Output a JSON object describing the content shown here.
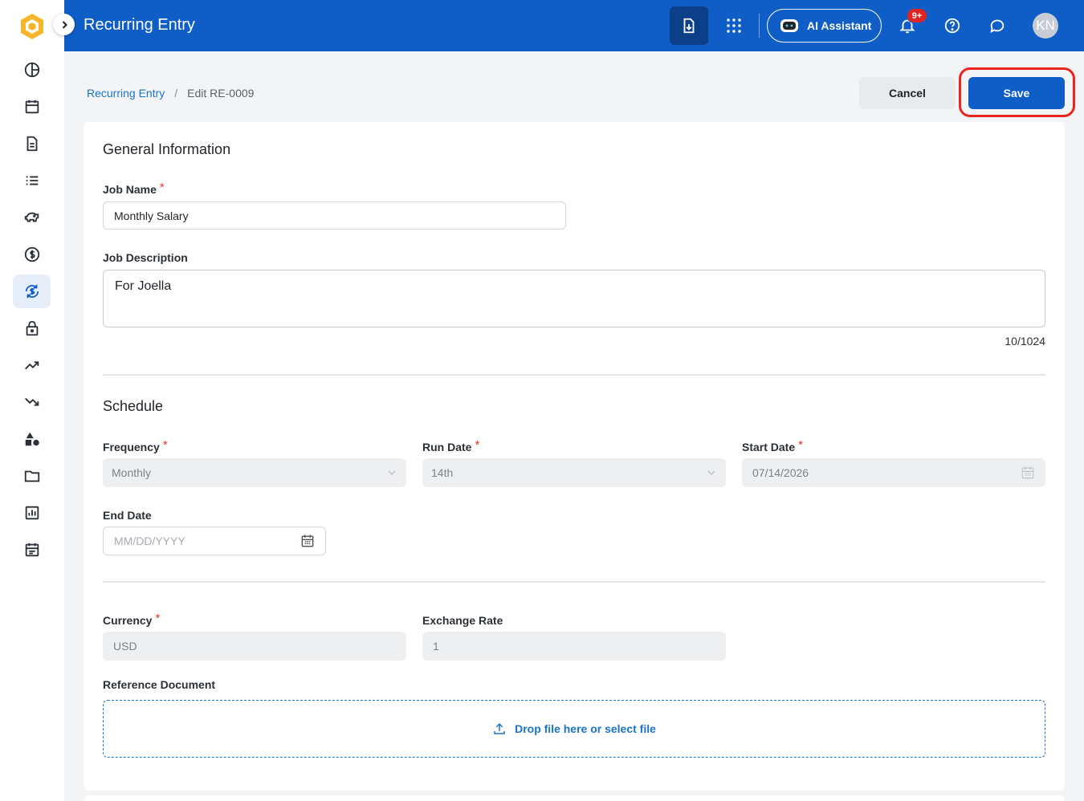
{
  "header": {
    "title": "Recurring Entry",
    "ai_assistant_label": "AI Assistant",
    "notification_badge": "9+",
    "avatar_initials": "KN",
    "brand_color": "#0f5ec8"
  },
  "sidebar": {
    "active_item": "recurring-entry",
    "items": [
      "dashboard-icon",
      "calendar-icon",
      "document-icon",
      "list-icon",
      "piggy-bank-icon",
      "dollar-icon",
      "recurring-dollar-icon",
      "lock-icon",
      "trending-up-icon",
      "trending-down-icon",
      "shapes-icon",
      "folder-icon",
      "report-icon",
      "schedule-icon"
    ]
  },
  "breadcrumb": {
    "parent": "Recurring Entry",
    "separator": "/",
    "current": "Edit RE-0009"
  },
  "actions": {
    "cancel_label": "Cancel",
    "save_label": "Save"
  },
  "general": {
    "section_title": "General Information",
    "job_name_label": "Job Name",
    "job_name_value": "Monthly Salary",
    "job_description_label": "Job Description",
    "job_description_value": "For Joella",
    "char_counter": "10/1024"
  },
  "schedule": {
    "section_title": "Schedule",
    "frequency_label": "Frequency",
    "frequency_value": "Monthly",
    "run_date_label": "Run Date",
    "run_date_value": "14th",
    "start_date_label": "Start Date",
    "start_date_value": "07/14/2026",
    "end_date_label": "End Date",
    "end_date_placeholder": "MM/DD/YYYY"
  },
  "currency": {
    "currency_label": "Currency",
    "currency_value": "USD",
    "exchange_rate_label": "Exchange Rate",
    "exchange_rate_value": "1"
  },
  "reference": {
    "label": "Reference Document",
    "dropzone_text": "Drop file here or select file"
  },
  "required_marker": "*"
}
